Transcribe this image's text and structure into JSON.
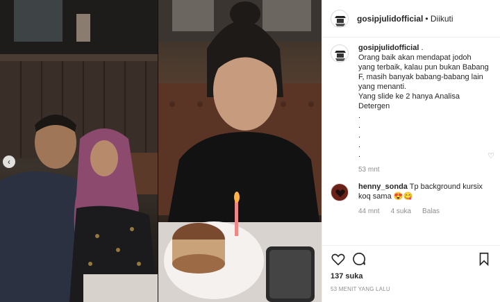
{
  "post": {
    "username": "gosipjulidofficial",
    "follow_status": "• Diikuti",
    "caption_lines": [
      "Orang baik akan mendapat jodoh",
      "yang terbaik, kalau pun bukan Babang",
      "F, masih banyak babang-babang lain",
      "yang menanti.",
      "Yang slide ke 2 hanya Analisa",
      "Detergen",
      ".",
      ".",
      ".",
      ".",
      "."
    ],
    "caption_time": "53 mnt",
    "likes": "137 suka",
    "time_ago": "53 MENIT YANG LALU"
  },
  "comment": {
    "username": "henny_sonda",
    "text": "Tp background kursix koq sama",
    "emoji": "😍😋",
    "time": "44 mnt",
    "likes": "4 suka",
    "reply": "Balas"
  },
  "icons": {
    "prev": "chevron-left-icon",
    "like": "heart-icon",
    "comment": "comment-icon",
    "save": "bookmark-icon"
  },
  "colors": {
    "text": "#262626",
    "muted": "#8e8e8e",
    "border": "#efefef"
  }
}
